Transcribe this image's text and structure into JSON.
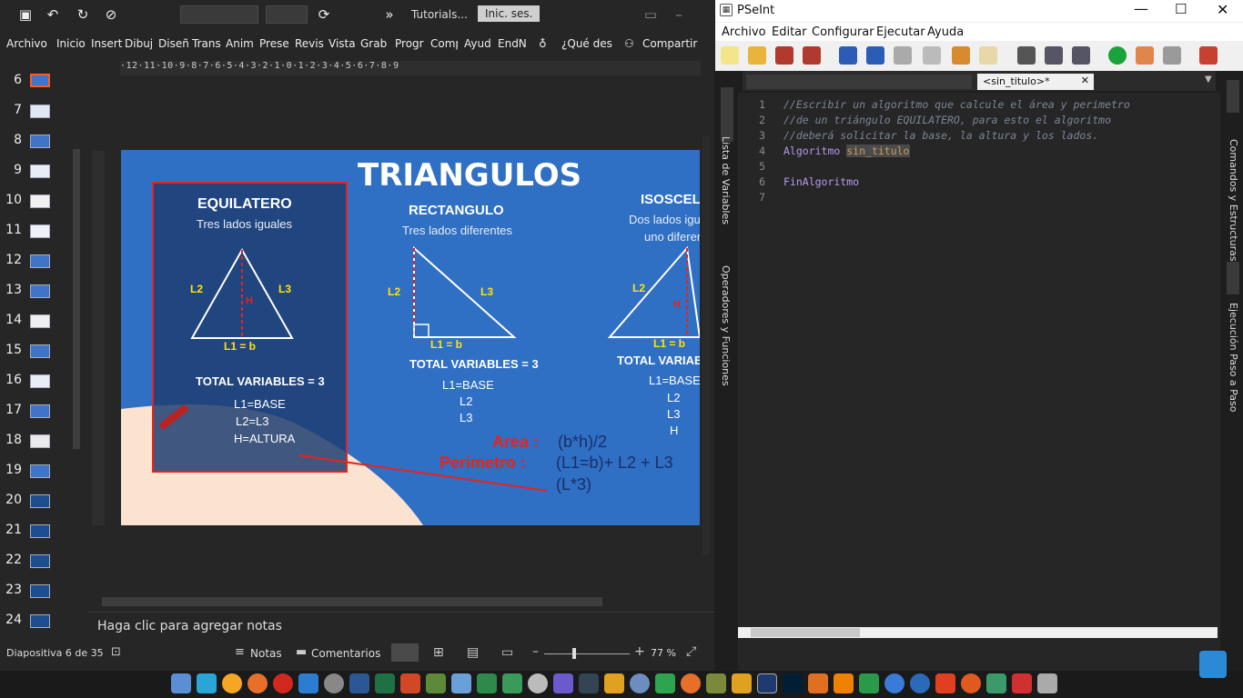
{
  "ppt": {
    "qat": {
      "tutorials": "Tutorials...",
      "signin": "Inic. ses."
    },
    "tabs": [
      "Archivo",
      "Inicio",
      "Insert",
      "Dibuj",
      "Diseñ",
      "Trans",
      "Anim",
      "Prese",
      "Revis",
      "Vista",
      "Graba",
      "Progr",
      "Comp",
      "Ayud",
      "EndN",
      "¿Qué des",
      "Compartir"
    ],
    "thumbs": [
      "6",
      "7",
      "8",
      "9",
      "10",
      "11",
      "12",
      "13",
      "14",
      "15",
      "16",
      "17",
      "18",
      "19",
      "20",
      "21",
      "22",
      "23",
      "24"
    ],
    "ruler": "·12·11·10·9·8·7·6·5·4·3·2·1·0·1·2·3·4·5·6·7·8·9",
    "slide": {
      "title": "TRIANGULOS",
      "equi": {
        "name": "EQUILATERO",
        "sub": "Tres lados iguales",
        "l2": "L2",
        "l3": "L3",
        "h": "H",
        "base": "L1 = b",
        "total": "TOTAL VARIABLES = 3",
        "v1": "L1=BASE",
        "v2": "L2=L3",
        "v3": "H=ALTURA"
      },
      "rect": {
        "name": "RECTANGULO",
        "sub": "Tres lados diferentes",
        "l2": "L2",
        "l3": "L3",
        "base": "L1 = b",
        "total": "TOTAL VARIABLES = 3",
        "v1": "L1=BASE",
        "v2": "L2",
        "v3": "L3"
      },
      "iso": {
        "name": "ISOSCEL",
        "sub1": "Dos lados igu",
        "sub2": "uno diferen",
        "l2": "L2",
        "h": "H",
        "base": "L1 = b",
        "total": "TOTAL VARIABLE",
        "v1": "L1=BASE",
        "v2": "L2",
        "v3": "L3",
        "v4": "H"
      },
      "area_label": "Area :",
      "area_val": "(b*h)/2",
      "per_label": "Perimetro :",
      "per_val": "(L1=b)+ L2 + L3",
      "per_val2": "(L*3)"
    },
    "notes": "Haga clic para agregar notas",
    "status": {
      "slide": "Diapositiva 6 de 35",
      "notes": "Notas",
      "comments": "Comentarios",
      "zoom": "77 %"
    }
  },
  "pseint": {
    "title": "PSeInt",
    "menu": [
      "Archivo",
      "Editar",
      "Configurar",
      "Ejecutar",
      "Ayuda"
    ],
    "tab": "<sin_titulo>*",
    "side_left": [
      "Lista de Variables",
      "Operadores y Funciones"
    ],
    "side_right": [
      "Comandos y Estructuras",
      "Ejecución Paso a Paso"
    ],
    "lines": [
      {
        "n": "1",
        "text": "//Escribir un algoritmo que calcule el área y perimetro"
      },
      {
        "n": "2",
        "text": "//de un triángulo EQUILATERO, para esto el algoritmo"
      },
      {
        "n": "3",
        "text": "//deberá solicitar la base, la altura y los lados."
      },
      {
        "n": "4",
        "kw": "Algoritmo",
        "id": "sin_titulo"
      },
      {
        "n": "5",
        "text": ""
      },
      {
        "n": "6",
        "kw": "FinAlgoritmo"
      },
      {
        "n": "7",
        "text": ""
      }
    ]
  },
  "colors": {
    "slide_bg": "#2f6fc4",
    "highlight_box": "#e8231c",
    "pse_keyword": "#b799ee"
  }
}
